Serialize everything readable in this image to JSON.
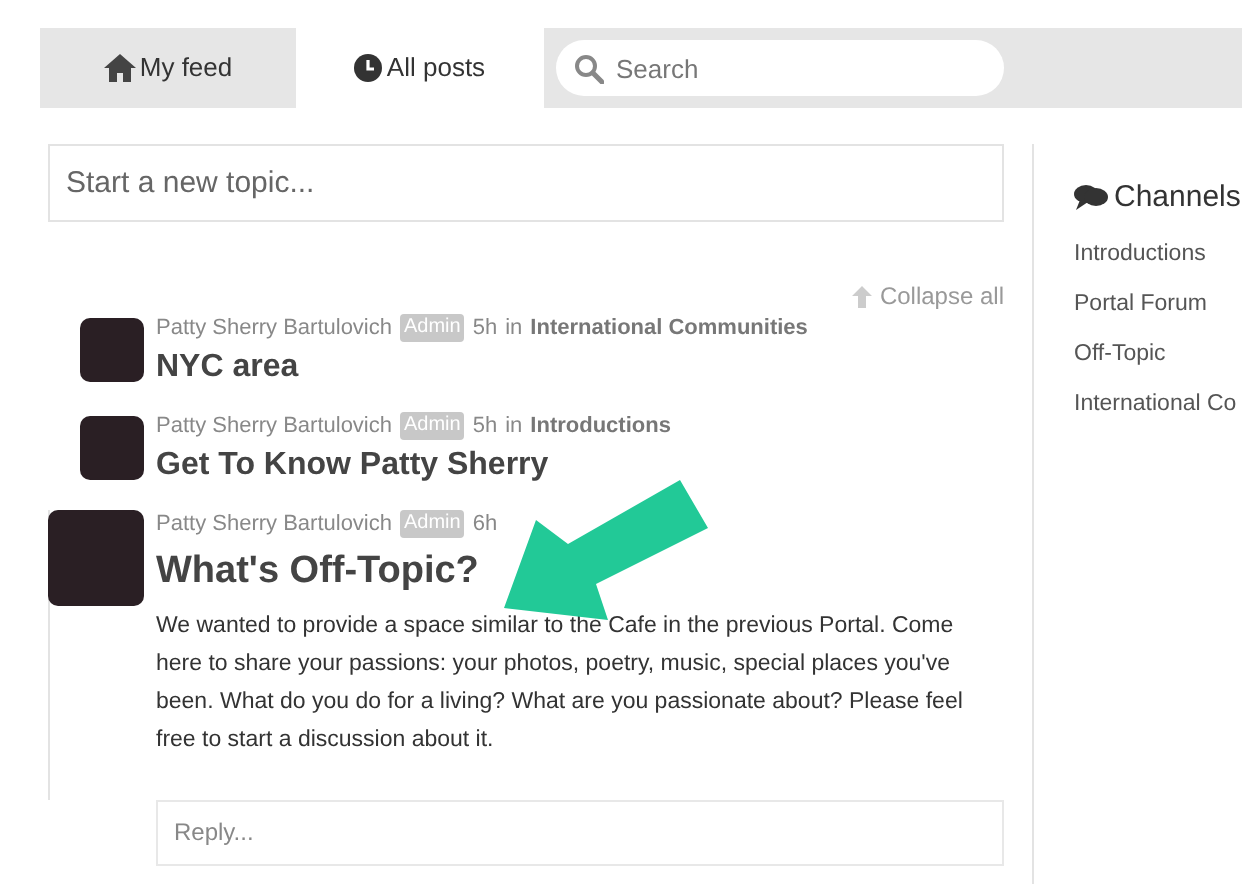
{
  "tabs": [
    {
      "label": "My feed",
      "selected": false
    },
    {
      "label": "All posts",
      "selected": true
    }
  ],
  "search": {
    "placeholder": "Search"
  },
  "new_topic": {
    "placeholder": "Start a new topic..."
  },
  "collapse_all": "Collapse all",
  "posts": [
    {
      "author": "Patty Sherry Bartulovich",
      "badge": "Admin",
      "time": "5h",
      "in": "in",
      "channel": "International Communities",
      "title": "NYC area",
      "expanded": false
    },
    {
      "author": "Patty Sherry Bartulovich",
      "badge": "Admin",
      "time": "5h",
      "in": "in",
      "channel": "Introductions",
      "title": "Get To Know Patty Sherry",
      "expanded": false
    },
    {
      "author": "Patty Sherry Bartulovich",
      "badge": "Admin",
      "time": "6h",
      "title": "What's Off-Topic?",
      "expanded": true,
      "body": "We wanted to provide a space similar to the Cafe in the previous Portal. Come here to share your passions: your photos, poetry, music, special places you've been. What do you do for a living? What are you passionate about? Please feel free to start a discussion about it.",
      "reply_placeholder": "Reply..."
    }
  ],
  "channels": {
    "title": "Channels",
    "items": [
      "Introductions",
      "Portal Forum",
      "Off-Topic",
      "International Co"
    ]
  }
}
